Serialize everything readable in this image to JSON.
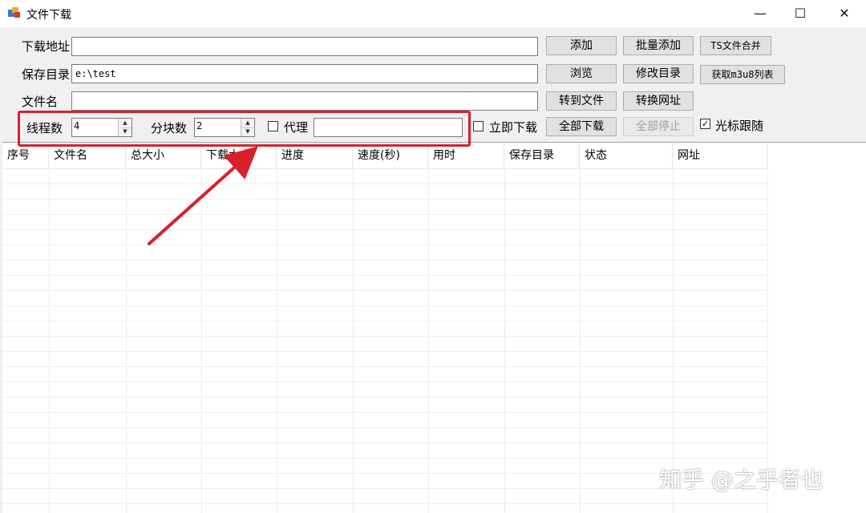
{
  "window": {
    "title": "文件下载",
    "minimize_glyph": "—",
    "maximize_glyph": "☐",
    "close_glyph": "✕",
    "icon": "app-window-icon"
  },
  "form": {
    "url_label": "下载地址",
    "url_value": "",
    "save_dir_label": "保存目录",
    "save_dir_value": "e:\\test",
    "file_name_label": "文件名",
    "file_name_value": "",
    "thread_label": "线程数",
    "thread_value": "4",
    "chunk_label": "分块数",
    "chunk_value": "2",
    "proxy_label": "代理",
    "proxy_checked": false,
    "proxy_value": "",
    "immediate_label": "立即下载",
    "immediate_checked": false,
    "cursor_follow_label": "光标跟随",
    "cursor_follow_checked": true
  },
  "buttons": {
    "add": "添加",
    "batch_add": "批量添加",
    "ts_merge": "TS文件合并",
    "browse": "浏览",
    "change_dir": "修改目录",
    "get_m3u8": "获取m3u8列表",
    "to_file": "转到文件",
    "convert_url": "转换网址",
    "download_all": "全部下载",
    "stop_all": "全部停止"
  },
  "table": {
    "columns": [
      "序号",
      "文件名",
      "总大小",
      "下载大小",
      "进度",
      "速度(秒)",
      "用时",
      "保存目录",
      "状态",
      "网址"
    ],
    "rows": []
  },
  "annotation": {
    "highlight_color": "#d9202a"
  },
  "watermark": "知乎 @之乎者也"
}
